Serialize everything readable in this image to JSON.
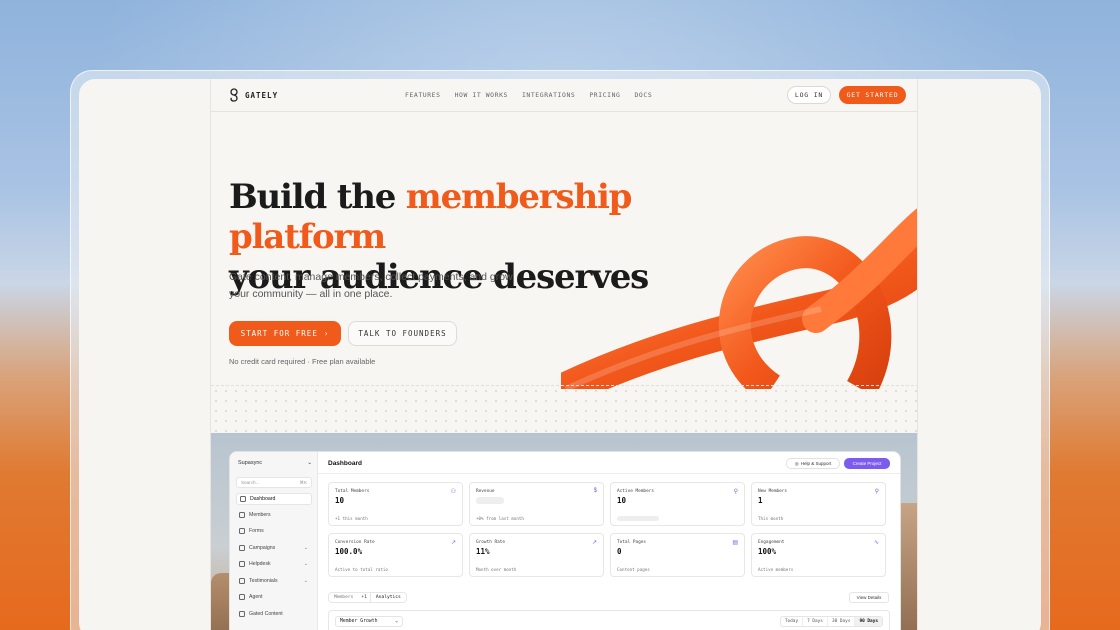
{
  "nav": {
    "brand": "GATELY",
    "links": [
      "FEATURES",
      "HOW IT WORKS",
      "INTEGRATIONS",
      "PRICING",
      "DOCS"
    ],
    "login_label": "LOG IN",
    "cta_label": "GET STARTED"
  },
  "hero": {
    "title_prefix": "Build the ",
    "title_accent": "membership platform",
    "title_line2": "your audience deserves",
    "subtitle": "Gate content, manage members, collect payments, and grow your community — all in one place.",
    "primary_label": "START FOR FREE",
    "secondary_label": "TALK TO FOUNDERS",
    "note": "No credit card required · Free plan available"
  },
  "dashboard": {
    "workspace": "Supasync",
    "search_placeholder": "Search...",
    "search_shortcut": "⌘K",
    "sidebar": [
      {
        "label": "Dashboard",
        "icon": "grid-icon",
        "active": true,
        "chevron": false
      },
      {
        "label": "Members",
        "icon": "users-icon",
        "active": false,
        "chevron": false
      },
      {
        "label": "Forms",
        "icon": "form-icon",
        "active": false,
        "chevron": false
      },
      {
        "label": "Campaigns",
        "icon": "mail-icon",
        "active": false,
        "chevron": true
      },
      {
        "label": "Helpdesk",
        "icon": "headset-icon",
        "active": false,
        "chevron": true
      },
      {
        "label": "Testimonials",
        "icon": "chat-icon",
        "active": false,
        "chevron": true
      },
      {
        "label": "Agent",
        "icon": "bot-icon",
        "active": false,
        "chevron": false
      },
      {
        "label": "Gated Content",
        "icon": "lock-icon",
        "active": false,
        "chevron": false
      }
    ],
    "title": "Dashboard",
    "help_label": "Help & Support",
    "create_label": "Create Project",
    "cards": [
      {
        "label": "Total Members",
        "value": "10",
        "note": "+1 this month",
        "icon": "users-icon"
      },
      {
        "label": "Revenue",
        "value": "",
        "note": "+0% from last month",
        "icon": "dollar-icon"
      },
      {
        "label": "Active Members",
        "value": "10",
        "note": "",
        "icon": "user-check-icon"
      },
      {
        "label": "New Members",
        "value": "1",
        "note": "This month",
        "icon": "user-plus-icon"
      },
      {
        "label": "Conversion Rate",
        "value": "100.0%",
        "note": "Active to total ratio",
        "icon": "trend-icon"
      },
      {
        "label": "Growth Rate",
        "value": "11%",
        "note": "Month over month",
        "icon": "trend-icon"
      },
      {
        "label": "Total Pages",
        "value": "0",
        "note": "Content pages",
        "icon": "file-icon"
      },
      {
        "label": "Engagement",
        "value": "100%",
        "note": "Active members",
        "icon": "pulse-icon"
      }
    ],
    "tabs": {
      "members": "Members",
      "members_badge": "+1",
      "analytics": "Analytics"
    },
    "view_details": "View Details",
    "growth_select": "Member Growth",
    "ranges": [
      "Today",
      "7 Days",
      "30 Days",
      "90 Days"
    ],
    "active_range": "90 Days"
  },
  "colors": {
    "accent": "#f05a1a",
    "purple": "#7c5cf0"
  }
}
